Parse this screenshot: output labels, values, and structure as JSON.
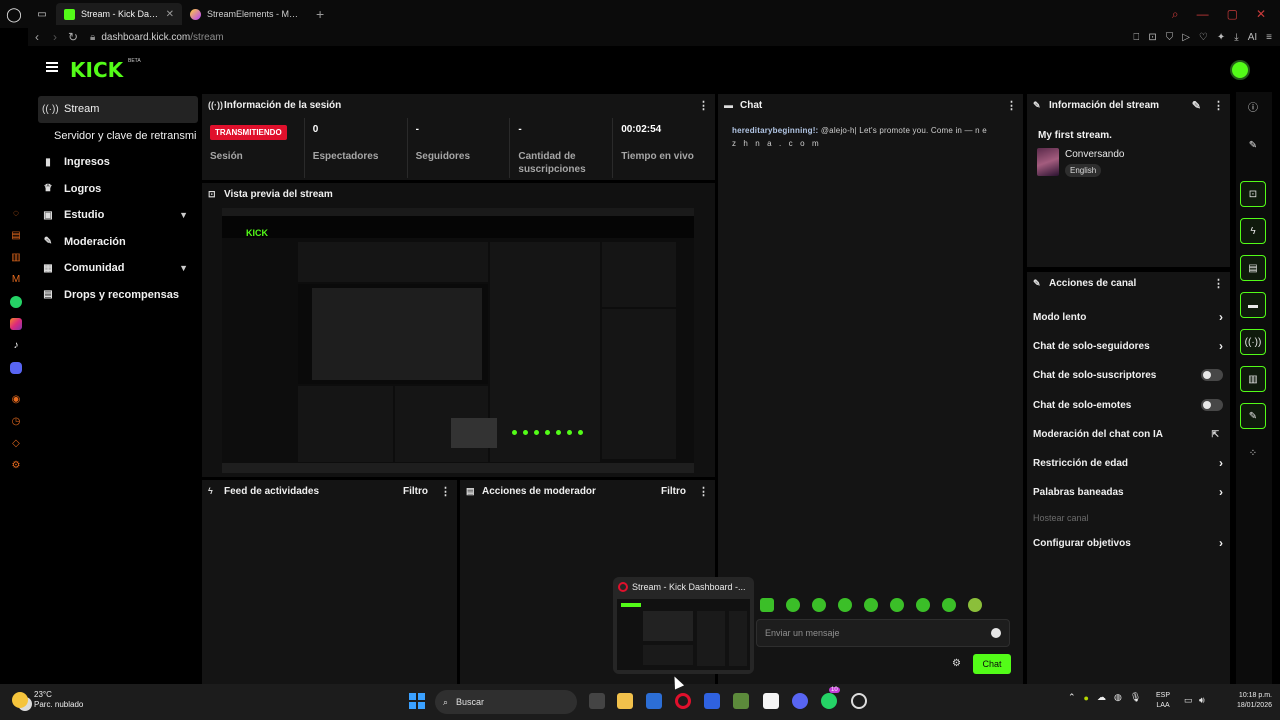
{
  "browser": {
    "tabs": [
      {
        "title": "Stream - Kick Dashboard",
        "active": true
      },
      {
        "title": "StreamElements - Multi-St",
        "active": false
      }
    ],
    "url_host": "dashboard.kick.com",
    "url_path": "/stream",
    "ai_label": "AI"
  },
  "header": {
    "logo": "KICK",
    "beta": "BETA"
  },
  "nav": {
    "items": [
      {
        "label": "Stream",
        "icon": "broadcast-icon"
      },
      {
        "label": "Servidor y clave de retransmi"
      },
      {
        "label": "Ingresos",
        "icon": "chart-icon"
      },
      {
        "label": "Logros",
        "icon": "trophy-icon"
      },
      {
        "label": "Estudio",
        "icon": "studio-icon"
      },
      {
        "label": "Moderación",
        "icon": "wrench-icon"
      },
      {
        "label": "Comunidad",
        "icon": "community-icon"
      },
      {
        "label": "Drops y recompensas",
        "icon": "drops-icon"
      }
    ]
  },
  "session": {
    "title": "Información de la sesión",
    "badge": "TRANSMITIENDO",
    "badge_label": "Sesión",
    "viewers_value": "0",
    "viewers_label": "Espectadores",
    "followers_value": "-",
    "followers_label": "Seguidores",
    "subs_value": "-",
    "subs_label": "Cantidad de suscripciones",
    "uptime_value": "00:02:54",
    "uptime_label": "Tiempo en vivo"
  },
  "preview": {
    "title": "Vista previa del stream",
    "inner_logo": "KICK"
  },
  "activity": {
    "title": "Feed de actividades",
    "filter": "Filtro"
  },
  "modactions": {
    "title": "Acciones de moderador",
    "filter": "Filtro"
  },
  "chat": {
    "title": "Chat",
    "message_user": "hereditarybeginning!:",
    "message_text": " @alejo-h| Let's promote you. Come in — n e",
    "message_cont": "z h n a . c o m",
    "input_placeholder": "Enviar un mensaje",
    "send_label": "Chat"
  },
  "stream_info": {
    "title": "Información del stream",
    "stream_title": "My first stream.",
    "category": "Conversando",
    "language": "English"
  },
  "channel_actions": {
    "title": "Acciones de canal",
    "items": [
      {
        "label": "Modo lento",
        "control": "chevron"
      },
      {
        "label": "Chat de solo-seguidores",
        "control": "chevron"
      },
      {
        "label": "Chat de solo-suscriptores",
        "control": "toggle",
        "on": false
      },
      {
        "label": "Chat de solo-emotes",
        "control": "toggle",
        "on": false
      },
      {
        "label": "Moderación del chat con IA",
        "control": "external"
      },
      {
        "label": "Restricción de edad",
        "control": "chevron"
      },
      {
        "label": "Palabras baneadas",
        "control": "chevron"
      },
      {
        "label": "Hostear canal",
        "control": "disabled"
      },
      {
        "label": "Configurar objetivos",
        "control": "chevron"
      }
    ]
  },
  "taskbar_popup": {
    "title": "Stream - Kick Dashboard -..."
  },
  "taskbar": {
    "weather_temp": "23°C",
    "weather_desc": "Parc. nublado",
    "search": "Buscar",
    "lang_line1": "ESP",
    "lang_line2": "LAA",
    "time": "10:18 p.m.",
    "date": "18/01/2026",
    "badge_count": "10"
  },
  "colors": {
    "kick_green": "#53fc18",
    "live_red": "#e0102c",
    "panel_bg": "#141414"
  }
}
